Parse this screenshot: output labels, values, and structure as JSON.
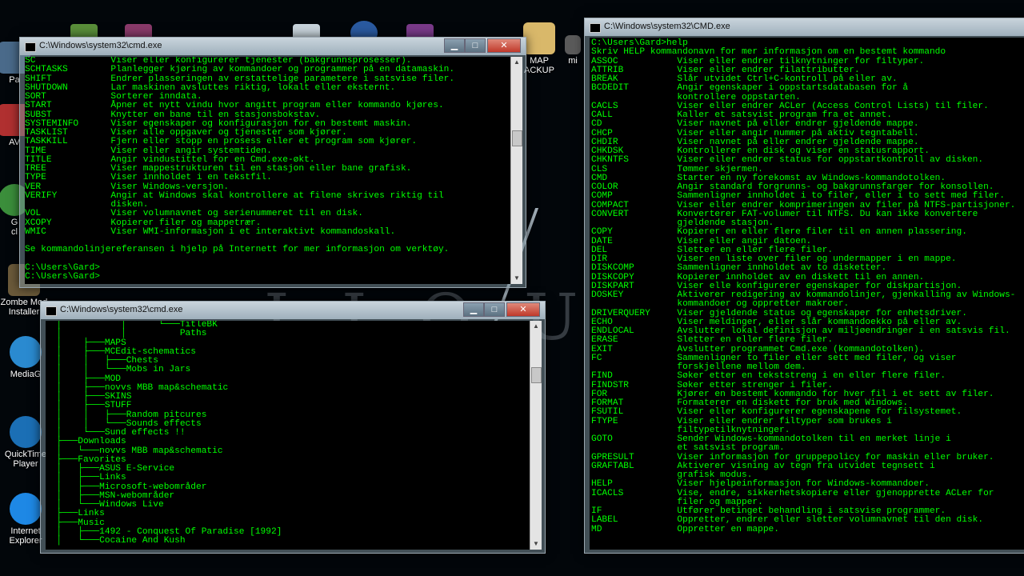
{
  "desktop": {
    "icons": [
      {
        "label": "Pa",
        "color": "#4a6a8a"
      },
      {
        "label": "AV",
        "color": "#b03030"
      },
      {
        "label": "G\ncl",
        "color": "#3b8e3b"
      },
      {
        "label": "Zombe Mod\nInstaller",
        "color": "#6b5a3a"
      },
      {
        "label": "MediaG",
        "color": "#2a8ad0"
      },
      {
        "label": "QuickTime\nPlayer",
        "color": "#1b6fb5"
      },
      {
        "label": "Internet\nExplorer",
        "color": "#1e88e5"
      },
      {
        "label": "MAP\nACKUP",
        "color": "#d9b86a"
      },
      {
        "label": "mi",
        "color": "#5a5a5a"
      }
    ],
    "wallpaper_text": "I I O U"
  },
  "window1": {
    "title": "C:\\Windows\\system32\\cmd.exe",
    "lines": [
      "SC              Viser eller konfigurerer tjenester (bakgrunnsprosesser).",
      "SCHTASKS        Planlegger kjøring av kommandoer og programmer på en datamaskin.",
      "SHIFT           Endrer plasseringen av erstattelige parametere i satsvise filer.",
      "SHUTDOWN        Lar maskinen avsluttes riktig, lokalt eller eksternt.",
      "SORT            Sorterer inndata.",
      "START           Åpner et nytt vindu hvor angitt program eller kommando kjøres.",
      "SUBST           Knytter en bane til en stasjonsbokstav.",
      "SYSTEMINFO      Viser egenskaper og konfigurasjon for en bestemt maskin.",
      "TASKLIST        Viser alle oppgaver og tjenester som kjører.",
      "TASKKILL        Fjern eller stopp en prosess eller et program som kjører.",
      "TIME            Viser eller angir systemtiden.",
      "TITLE           Angir vindustittel for en Cmd.exe-økt.",
      "TREE            Viser mappestrukturen til en stasjon eller bane grafisk.",
      "TYPE            Viser innholdet i en tekstfil.",
      "VER             Viser Windows-versjon.",
      "VERIFY          Angir at Windows skal kontrollere at filene skrives riktig til",
      "                disken.",
      "VOL             Viser volumnavnet og serienummeret til en disk.",
      "XCOPY           Kopierer filer og mappetrær.",
      "WMIC            Viser WMI-informasjon i et interaktivt kommandoskall.",
      "",
      "Se kommandolinjereferansen i hjelp på Internett for mer informasjon om verktøy.",
      "",
      "C:\\Users\\Gard>",
      "C:\\Users\\Gard>"
    ]
  },
  "window2": {
    "title": "C:\\Windows\\system32\\cmd.exe",
    "lines": [
      "  │           │      └───TitleBK",
      "  │           │          Paths",
      "  │    ├───MAPS",
      "  │    ├───MCEdit-schematics",
      "  │    │   ├───Chests",
      "  │    │   └───Mobs in Jars",
      "  │    ├───MOD",
      "  │    ├───novvs MBB map&schematic",
      "  │    ├───SKINS",
      "  │    ├───STUFF",
      "  │    │   ├───Random pitcures",
      "  │    │   └───Sounds effects",
      "  │    └───Sund effects !!",
      "  ├───Downloads",
      "  │   └───novvs MBB map&schematic",
      "  ├───Favorites",
      "  │   ├───ASUS E-Service",
      "  │   ├───Links",
      "  │   ├───Microsoft-webområder",
      "  │   ├───MSN-webområder",
      "  │   └───Windows Live",
      "  ├───Links",
      "  ├───Music",
      "  │   ├───1492 - Conquest Of Paradise [1992]",
      "  │   └───Cocaine And Kush"
    ]
  },
  "window3": {
    "title": "C:\\Windows\\system32\\CMD.exe",
    "lines": [
      "C:\\Users\\Gard>help",
      "Skriv HELP kommandonavn for mer informasjon om en bestemt kommando",
      "ASSOC           Viser eller endrer tilknytninger for filtyper.",
      "ATTRIB          Viser eller endrer filattributter.",
      "BREAK           Slår utvidet Ctrl+C-kontroll på eller av.",
      "BCDEDIT         Angir egenskaper i oppstartsdatabasen for å",
      "                kontrollere oppstarten.",
      "CACLS           Viser eller endrer ACLer (Access Control Lists) til filer.",
      "CALL            Kaller et satsvist program fra et annet.",
      "CD              Viser navnet på eller endrer gjeldende mappe.",
      "CHCP            Viser eller angir nummer på aktiv tegntabell.",
      "CHDIR           Viser navnet på eller endrer gjeldende mappe.",
      "CHKDSK          Kontrollerer en disk og viser en statusrapport.",
      "CHKNTFS         Viser eller endrer status for oppstartkontroll av disken.",
      "CLS             Tømmer skjermen.",
      "CMD             Starter en ny forekomst av Windows-kommandotolken.",
      "COLOR           Angir standard forgrunns- og bakgrunnsfarger for konsollen.",
      "COMP            Sammenligner innholdet i to filer, eller i to sett med filer.",
      "COMPACT         Viser eller endrer komprimeringen av filer på NTFS-partisjoner.",
      "CONVERT         Konverterer FAT-volumer til NTFS. Du kan ikke konvertere",
      "                gjeldende stasjon.",
      "COPY            Kopierer en eller flere filer til en annen plassering.",
      "DATE            Viser eller angir datoen.",
      "DEL             Sletter en eller flere filer.",
      "DIR             Viser en liste over filer og undermapper i en mappe.",
      "DISKCOMP        Sammenligner innholdet av to disketter.",
      "DISKCOPY        Kopierer innholdet av en diskett til en annen.",
      "DISKPART        Viser elle konfigurerer egenskaper for diskpartisjon.",
      "DOSKEY          Aktiverer redigering av kommandolinjer, gjenkalling av Windows-",
      "                kommandoer og oppretter makroer.",
      "DRIVERQUERY     Viser gjeldende status og egenskaper for enhetsdriver.",
      "ECHO            Viser meldinger, eller slår kommandoekko på eller av.",
      "ENDLOCAL        Avslutter lokal definisjon av miljøendringer i en satsvis fil.",
      "ERASE           Sletter en eller flere filer.",
      "EXIT            Avslutter programmet Cmd.exe (kommandotolken).",
      "FC              Sammenligner to filer eller sett med filer, og viser",
      "                forskjellene mellom dem.",
      "FIND            Søker etter en tekststreng i en eller flere filer.",
      "FINDSTR         Søker etter strenger i filer.",
      "FOR             Kjører en bestemt kommando for hver fil i et sett av filer.",
      "FORMAT          Formaterer en diskett for bruk med Windows.",
      "FSUTIL          Viser eller konfigurerer egenskapene for filsystemet.",
      "FTYPE           Viser eller endrer filtyper som brukes i",
      "                filtypetilknytninger.",
      "GOTO            Sender Windows-kommandotolken til en merket linje i",
      "                et satsvist program.",
      "GPRESULT        Viser informasjon for gruppepolicy for maskin eller bruker.",
      "GRAFTABL        Aktiverer visning av tegn fra utvidet tegnsett i",
      "                grafisk modus.",
      "HELP            Viser hjelpeinformasjon for Windows-kommandoer.",
      "ICACLS          Vise, endre, sikkerhetskopiere eller gjenopprette ACLer for",
      "                filer og mapper.",
      "IF              Utfører betinget behandling i satsvise programmer.",
      "LABEL           Oppretter, endrer eller sletter volumnavnet til den disk.",
      "MD              Oppretter en mappe."
    ]
  },
  "controls": {
    "min": "▁",
    "max": "□",
    "close": "✕"
  }
}
